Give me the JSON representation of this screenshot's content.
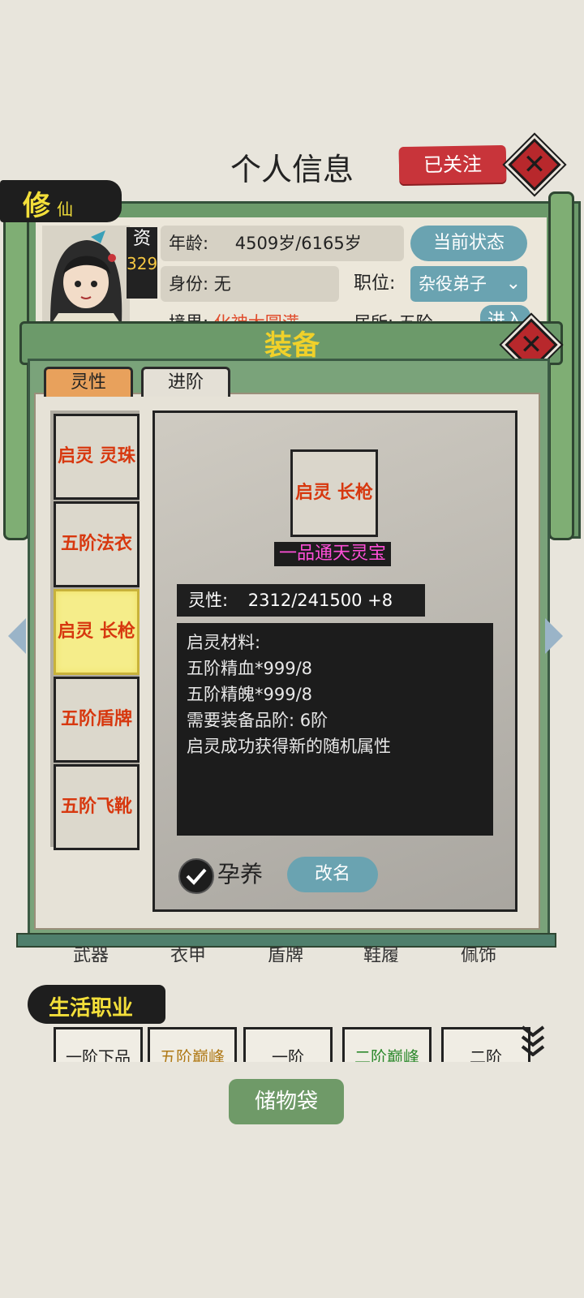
{
  "header": {
    "title": "个人信息",
    "follow_label": "已关注",
    "close_symbol": "✕"
  },
  "profile": {
    "tag_big": "修",
    "tag_small": "仙",
    "zi_label": "资",
    "zi_value": "329",
    "age_label": "年龄:",
    "age_value": "4509岁/6165岁",
    "state_button": "当前状态",
    "identity_label": "身份:",
    "identity_value": "无",
    "position_label": "职位:",
    "position_value": "杂役弟子",
    "realm_label": "境界:",
    "realm_value": "化神大圆满",
    "residence_label": "居所:",
    "residence_value": "五阶",
    "enter_button": "进入"
  },
  "equip_modal": {
    "title": "装备",
    "close_symbol": "✕",
    "tabs": [
      {
        "label": "灵性",
        "active": true
      },
      {
        "label": "进阶",
        "active": false
      }
    ],
    "slots": [
      {
        "label": "启灵 灵珠",
        "selected": false
      },
      {
        "label": "五阶法衣",
        "selected": false
      },
      {
        "label": "启灵 长枪",
        "selected": true
      },
      {
        "label": "五阶盾牌",
        "selected": false
      },
      {
        "label": "五阶飞靴",
        "selected": false
      }
    ],
    "item_name": "启灵 长枪",
    "item_grade": "一品通天灵宝",
    "lingxing_label": "灵性:",
    "lingxing_value": "2312/241500 +8",
    "description": [
      "启灵材料:",
      "五阶精血*999/8",
      "五阶精魄*999/8",
      "需要装备品阶: 6阶",
      "启灵成功获得新的随机属性"
    ],
    "nurture_label": "孕养",
    "nurture_checked": true,
    "rename_button": "改名"
  },
  "equip_slots_bottom": [
    "武器",
    "衣甲",
    "盾牌",
    "鞋履",
    "佩饰"
  ],
  "life": {
    "title": "生活职业",
    "cards": [
      "一阶下品",
      "五阶巅峰",
      "一阶",
      "二阶巅峰",
      "二阶"
    ]
  },
  "storage_button": "储物袋",
  "colors": {
    "accent_red": "#c8343a",
    "scroll_green": "#6c9a6a",
    "title_yellow": "#f0d12a",
    "item_red": "#d7380f",
    "grade_pink": "#ff4fd8"
  }
}
